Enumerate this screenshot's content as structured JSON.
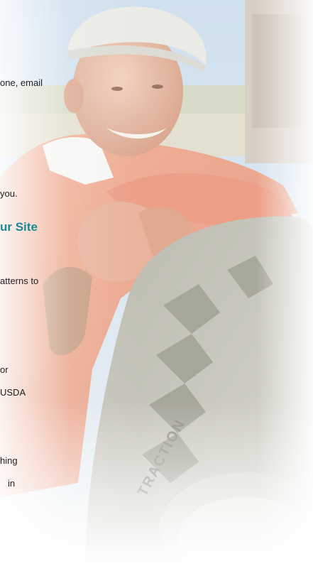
{
  "text_fragments": {
    "line1": "one, email",
    "line2": "you.",
    "heading": "ur Site",
    "line3": "atterns to",
    "line4": "or",
    "line5": "USDA",
    "line6": "hing",
    "line7": "in"
  },
  "colors": {
    "heading": "#1a8a99",
    "body_text": "#1f1f1f"
  }
}
